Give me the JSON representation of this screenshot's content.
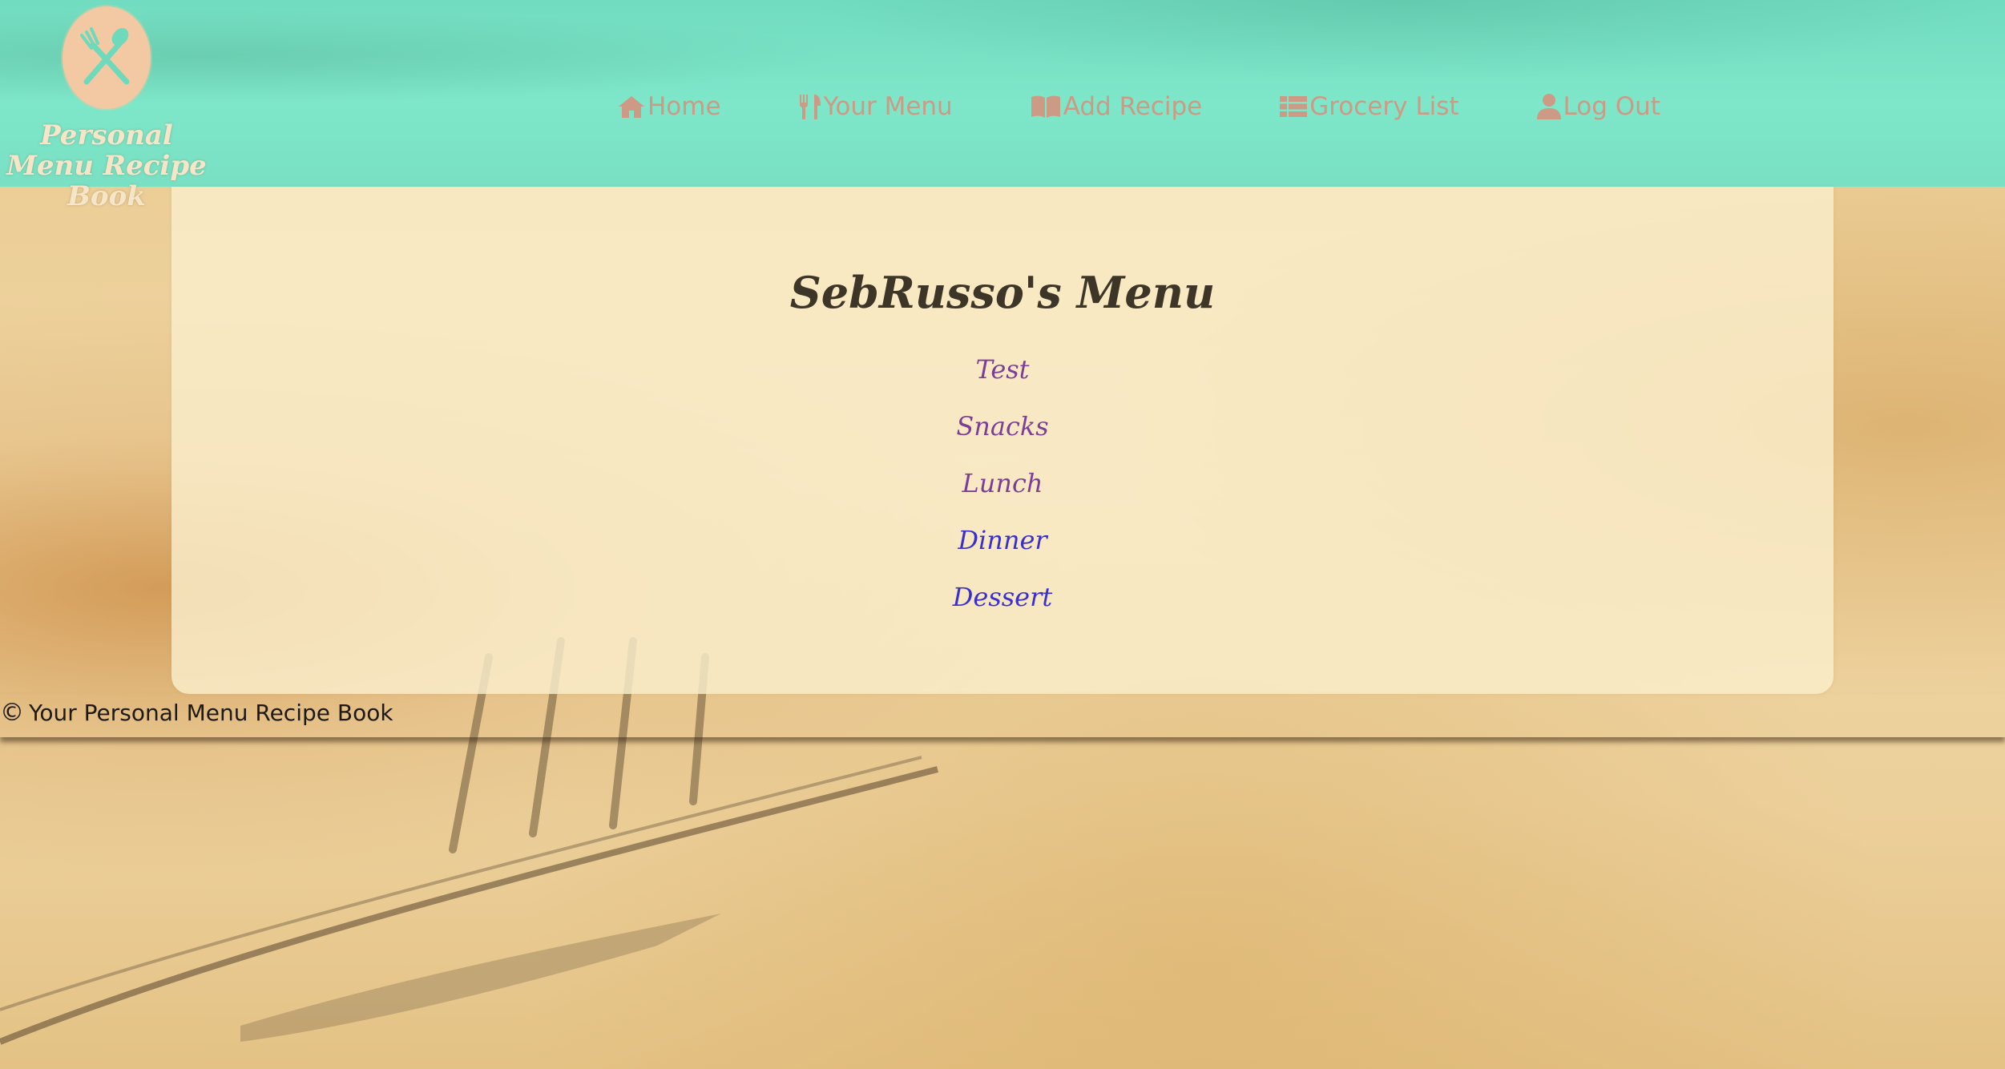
{
  "app": {
    "logo_line1": "Personal",
    "logo_line2": "Menu Recipe Book"
  },
  "nav": {
    "items": [
      {
        "label": "Home",
        "icon": "home-icon"
      },
      {
        "label": "Your Menu",
        "icon": "utensils-icon"
      },
      {
        "label": "Add Recipe",
        "icon": "book-open-icon"
      },
      {
        "label": "Grocery List",
        "icon": "list-icon"
      },
      {
        "label": "Log Out",
        "icon": "user-icon"
      }
    ]
  },
  "main": {
    "title": "SebRusso's Menu",
    "categories": [
      {
        "label": "Test",
        "state": "visited"
      },
      {
        "label": "Snacks",
        "state": "visited"
      },
      {
        "label": "Lunch",
        "state": "visited"
      },
      {
        "label": "Dinner",
        "state": "link"
      },
      {
        "label": "Dessert",
        "state": "link"
      }
    ]
  },
  "footer": {
    "copyright_symbol": "©",
    "text": "Your Personal Menu Recipe Book"
  },
  "colors": {
    "header_bg": "#7ee6c9",
    "nav_text": "#cd9a86",
    "title_text": "#3d3527",
    "visited_link": "#7b3f98",
    "link": "#3b2fd0",
    "card_bg": "#faeecc"
  }
}
